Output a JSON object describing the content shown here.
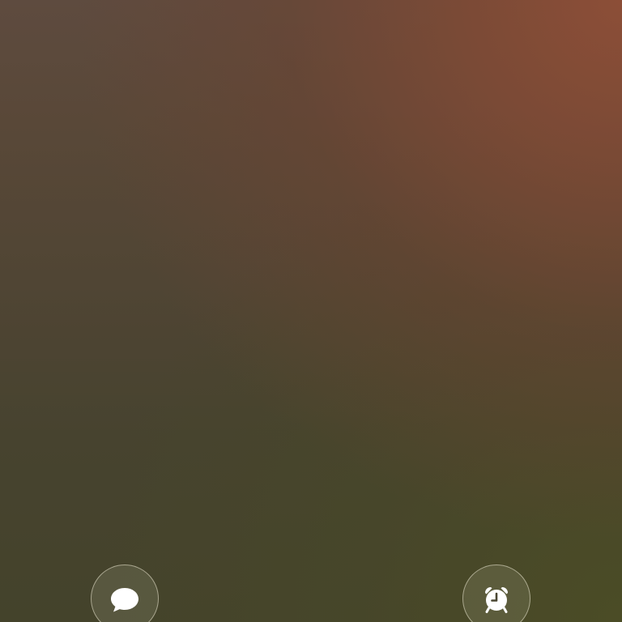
{
  "lockscreen": {
    "left_shortcut": {
      "icon": "message-bubble-icon",
      "color": "#ffffff"
    },
    "right_shortcut": {
      "icon": "alarm-clock-icon",
      "color": "#ffffff"
    }
  }
}
